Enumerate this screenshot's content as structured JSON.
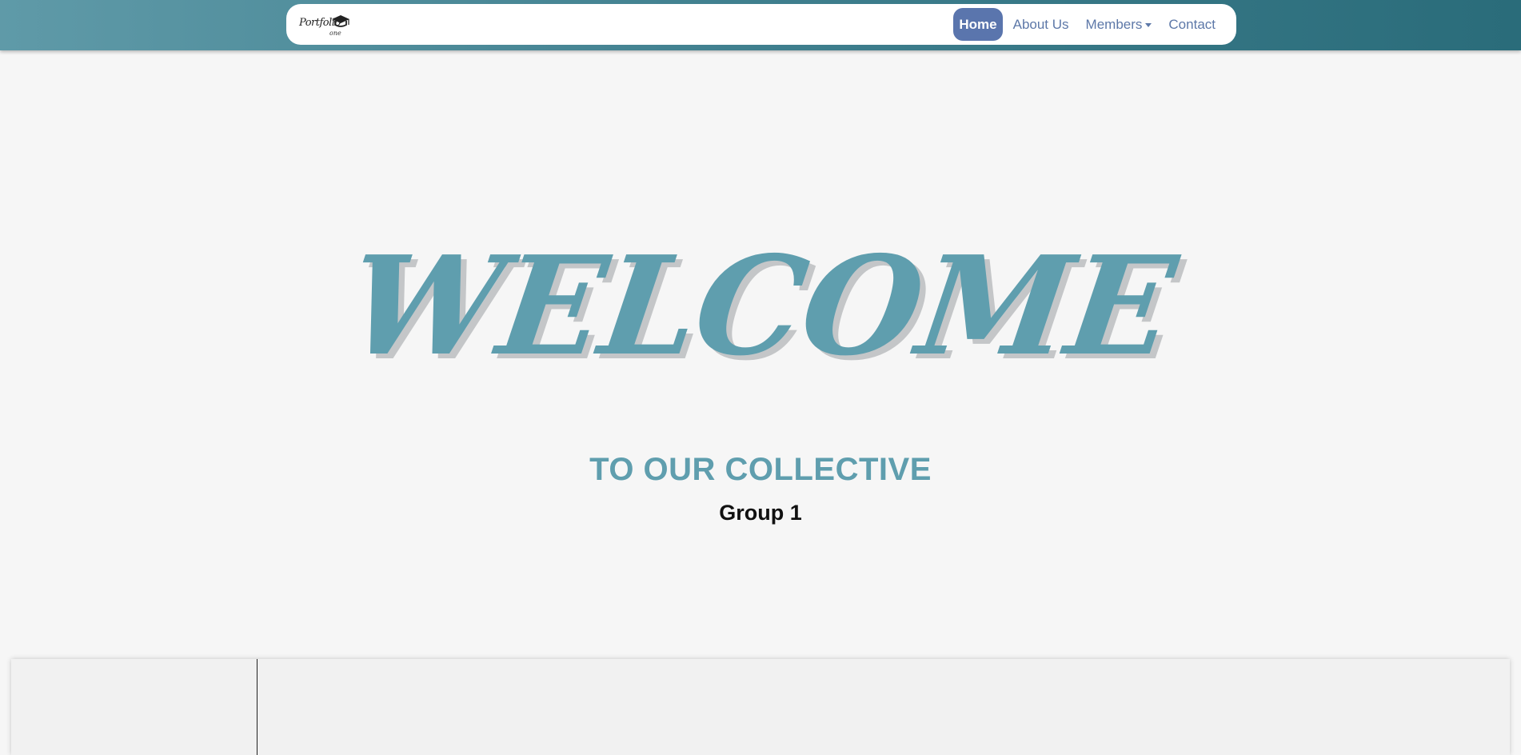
{
  "brand": {
    "logo_text": "Portfolio",
    "logo_sub": "one",
    "logo_icon": "graduation-cap-icon"
  },
  "nav": {
    "items": [
      {
        "label": "Home",
        "active": true
      },
      {
        "label": "About Us",
        "active": false
      },
      {
        "label": "Members",
        "active": false,
        "dropdown": true
      },
      {
        "label": "Contact",
        "active": false
      }
    ]
  },
  "hero": {
    "title": "WELCOME",
    "subtitle": "TO OUR COLLECTIVE",
    "group": "Group 1"
  },
  "colors": {
    "accent": "#5f9eae",
    "nav_active": "#5a75ad",
    "nav_link": "#5d78a8",
    "topbar_start": "#5f9aa8",
    "topbar_end": "#2a6c7a",
    "background": "#f6f6f6"
  }
}
